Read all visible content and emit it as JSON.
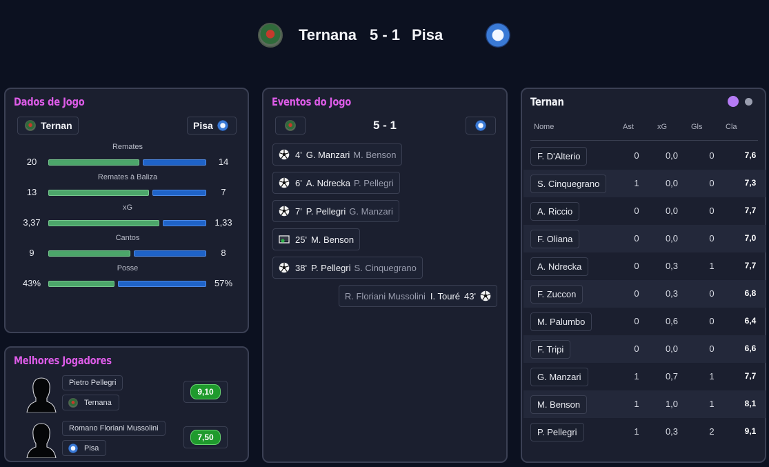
{
  "match": {
    "home": "Ternana",
    "away": "Pisa",
    "score": "5 - 1"
  },
  "colors": {
    "accent_title": "#dd5ce8",
    "home_bar": "#4ca66a",
    "away_bar": "#1f63c8",
    "rating_badge": "#1f9a2d",
    "dot_active": "#b57bf5",
    "dot_inactive": "#9a9eaf"
  },
  "stats_panel": {
    "title": "Dados de Jogo",
    "home_chip": "Ternan",
    "away_chip": "Pisa",
    "stats": [
      {
        "label": "Remates",
        "home": "20",
        "away": "14",
        "home_value": 20,
        "away_value": 14
      },
      {
        "label": "Remates à Baliza",
        "home": "13",
        "away": "7",
        "home_value": 13,
        "away_value": 7
      },
      {
        "label": "xG",
        "home": "3,37",
        "away": "1,33",
        "home_value": 3.37,
        "away_value": 1.33
      },
      {
        "label": "Cantos",
        "home": "9",
        "away": "8",
        "home_value": 9,
        "away_value": 8
      },
      {
        "label": "Posse",
        "home": "43%",
        "away": "57%",
        "home_value": 43,
        "away_value": 57
      }
    ]
  },
  "best_players": {
    "title": "Melhores Jogadores",
    "players": [
      {
        "name": "Pietro Pellegri",
        "team": "Ternana",
        "rating": "9,10",
        "icon": "ternana-crest-icon"
      },
      {
        "name": "Romano Floriani Mussolini",
        "team": "Pisa",
        "rating": "7,50",
        "icon": "pisa-crest-icon"
      }
    ]
  },
  "events_panel": {
    "title": "Eventos do Jogo",
    "score": "5 - 1",
    "events": [
      {
        "side": "home",
        "type": "goal",
        "icon": "soccer-ball-icon",
        "minute": "4'",
        "player": "G. Manzari",
        "assist": "M. Benson"
      },
      {
        "side": "home",
        "type": "goal",
        "icon": "soccer-ball-icon",
        "minute": "6'",
        "player": "A. Ndrecka",
        "assist": "P. Pellegri"
      },
      {
        "side": "home",
        "type": "goal",
        "icon": "soccer-ball-icon",
        "minute": "7'",
        "player": "P. Pellegri",
        "assist": "G. Manzari"
      },
      {
        "side": "home",
        "type": "penalty",
        "icon": "penalty-goal-icon",
        "minute": "25'",
        "player": "M. Benson",
        "assist": ""
      },
      {
        "side": "home",
        "type": "goal",
        "icon": "soccer-ball-icon",
        "minute": "38'",
        "player": "P. Pellegri",
        "assist": "S. Cinquegrano"
      },
      {
        "side": "away",
        "type": "goal",
        "icon": "soccer-ball-icon",
        "minute": "43'",
        "player": "I. Touré",
        "assist": "R. Floriani Mussolini"
      }
    ]
  },
  "lineup_panel": {
    "title": "Ternan",
    "columns": [
      "Nome",
      "Ast",
      "xG",
      "Gls",
      "Cla"
    ],
    "rows": [
      {
        "name": "F. D'Alterio",
        "ast": "0",
        "xg": "0,0",
        "gls": "0",
        "cla": "7,6"
      },
      {
        "name": "S. Cinquegrano",
        "ast": "1",
        "xg": "0,0",
        "gls": "0",
        "cla": "7,3"
      },
      {
        "name": "A. Riccio",
        "ast": "0",
        "xg": "0,0",
        "gls": "0",
        "cla": "7,7"
      },
      {
        "name": "F. Oliana",
        "ast": "0",
        "xg": "0,0",
        "gls": "0",
        "cla": "7,0"
      },
      {
        "name": "A. Ndrecka",
        "ast": "0",
        "xg": "0,3",
        "gls": "1",
        "cla": "7,7"
      },
      {
        "name": "F. Zuccon",
        "ast": "0",
        "xg": "0,3",
        "gls": "0",
        "cla": "6,8"
      },
      {
        "name": "M. Palumbo",
        "ast": "0",
        "xg": "0,6",
        "gls": "0",
        "cla": "6,4"
      },
      {
        "name": "F. Tripi",
        "ast": "0",
        "xg": "0,0",
        "gls": "0",
        "cla": "6,6"
      },
      {
        "name": "G. Manzari",
        "ast": "1",
        "xg": "0,7",
        "gls": "1",
        "cla": "7,7"
      },
      {
        "name": "M. Benson",
        "ast": "1",
        "xg": "1,0",
        "gls": "1",
        "cla": "8,1"
      },
      {
        "name": "P. Pellegri",
        "ast": "1",
        "xg": "0,3",
        "gls": "2",
        "cla": "9,1"
      }
    ]
  }
}
